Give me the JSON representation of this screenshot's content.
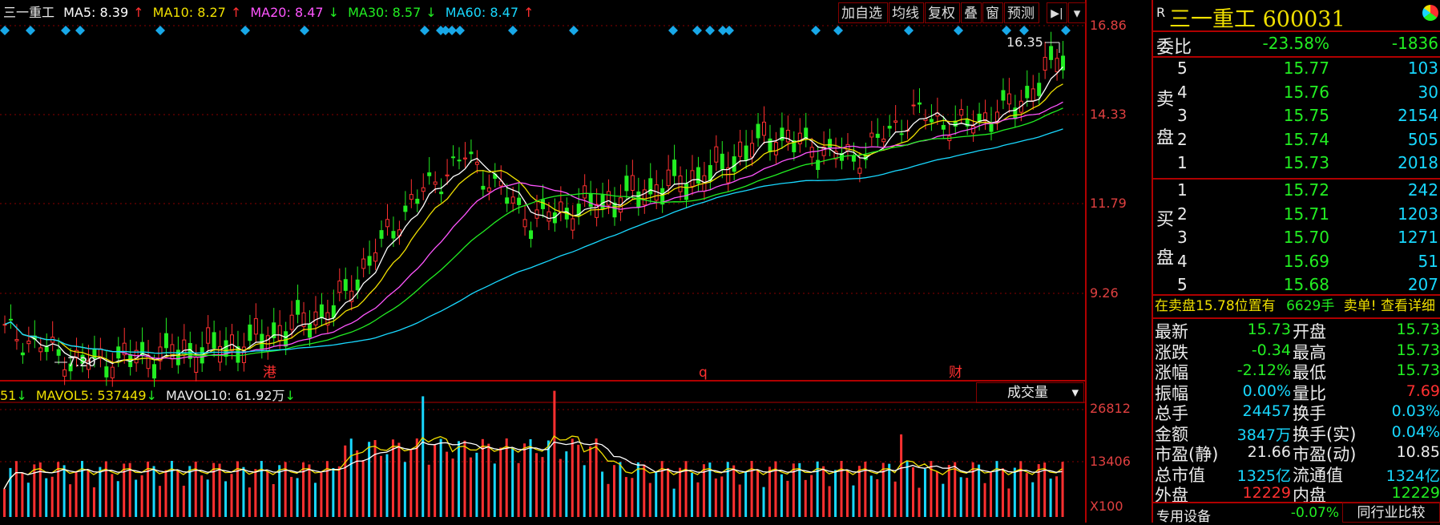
{
  "stock": {
    "name": "三一重工",
    "code": "600031",
    "rank": "R"
  },
  "ma_bar": {
    "label_name": "三一重工",
    "items": [
      {
        "label": "MA5: 8.39",
        "arrow": "↑",
        "color": "#ffffff"
      },
      {
        "label": "MA10: 8.27",
        "arrow": "↑",
        "color": "#f0e000"
      },
      {
        "label": "MA20: 8.47",
        "arrow": "↓",
        "color": "#ff55ff"
      },
      {
        "label": "MA30: 8.57",
        "arrow": "↓",
        "color": "#22ee22"
      },
      {
        "label": "MA60: 8.47",
        "arrow": "↑",
        "color": "#18d8ff"
      }
    ]
  },
  "toolbar": {
    "add_fav": "加自选",
    "avg_line": "均线",
    "restore": "复权",
    "overlay": "叠",
    "window": "窗",
    "forecast": "预测",
    "expand": "▶|",
    "menu": "▾"
  },
  "price_axis": [
    "16.86",
    "14.33",
    "11.79",
    "9.26"
  ],
  "chart_labels": {
    "max": "16.35",
    "min": "7.20",
    "marks": [
      "港",
      "q",
      "财"
    ]
  },
  "volume": {
    "header_prefix": "51",
    "mavol5": "MAVOL5: 537449",
    "mavol5_arrow": "↓",
    "mavol10": "MAVOL10: 61.92万",
    "mavol10_arrow": "↓",
    "selector": "成交量",
    "axis": [
      "26812",
      "13406"
    ],
    "multiplier": "X100"
  },
  "order_book": {
    "weibi_label": "委比",
    "weibi_pct": "-23.58%",
    "weibi_diff": "-1836",
    "sell_label": [
      "卖",
      "盘"
    ],
    "buy_label": [
      "买",
      "盘"
    ],
    "sell": [
      {
        "level": "5",
        "price": "15.77",
        "vol": "103"
      },
      {
        "level": "4",
        "price": "15.76",
        "vol": "30"
      },
      {
        "level": "3",
        "price": "15.75",
        "vol": "2154"
      },
      {
        "level": "2",
        "price": "15.74",
        "vol": "505"
      },
      {
        "level": "1",
        "price": "15.73",
        "vol": "2018"
      }
    ],
    "buy": [
      {
        "level": "1",
        "price": "15.72",
        "vol": "242"
      },
      {
        "level": "2",
        "price": "15.71",
        "vol": "1203"
      },
      {
        "level": "3",
        "price": "15.70",
        "vol": "1271"
      },
      {
        "level": "4",
        "price": "15.69",
        "vol": "51"
      },
      {
        "level": "5",
        "price": "15.68",
        "vol": "207"
      }
    ],
    "notice_a": "在卖盘15.78位置有",
    "notice_b": "6629手",
    "notice_c": "卖单! 查看详细"
  },
  "quote": {
    "rows": [
      {
        "l1": "最新",
        "v1": "15.73",
        "c1": "green",
        "l2": "开盘",
        "v2": "15.73",
        "c2": "green"
      },
      {
        "l1": "涨跌",
        "v1": "-0.34",
        "c1": "green",
        "l2": "最高",
        "v2": "15.73",
        "c2": "green"
      },
      {
        "l1": "涨幅",
        "v1": "-2.12%",
        "c1": "green",
        "l2": "最低",
        "v2": "15.73",
        "c2": "green"
      },
      {
        "l1": "振幅",
        "v1": "0.00%",
        "c1": "cyan",
        "l2": "量比",
        "v2": "7.69",
        "c2": "red"
      },
      {
        "l1": "总手",
        "v1": "24457",
        "c1": "cyan",
        "l2": "换手",
        "v2": "0.03%",
        "c2": "cyan"
      },
      {
        "l1": "金额",
        "v1": "3847万",
        "c1": "cyan",
        "l2": "换手(实)",
        "v2": "0.04%",
        "c2": "cyan"
      },
      {
        "l1": "市盈(静)",
        "v1": "21.66",
        "c1": "white",
        "l2": "市盈(动)",
        "v2": "10.85",
        "c2": "white"
      },
      {
        "l1": "总市值",
        "v1": "1325亿",
        "c1": "cyan",
        "l2": "流通值",
        "v2": "1324亿",
        "c2": "cyan"
      },
      {
        "l1": "外盘",
        "v1": "12229",
        "c1": "red",
        "l2": "内盘",
        "v2": "12229",
        "c2": "green"
      }
    ],
    "sector": "专用设备",
    "sector_pct": "-0.07%",
    "compare_btn": "同行业比较"
  },
  "colors": {
    "frame": "#b00000",
    "up": "#ff3030",
    "down": "#22ee22",
    "cyan": "#18d8ff",
    "diamond": "#18a8e8"
  }
}
